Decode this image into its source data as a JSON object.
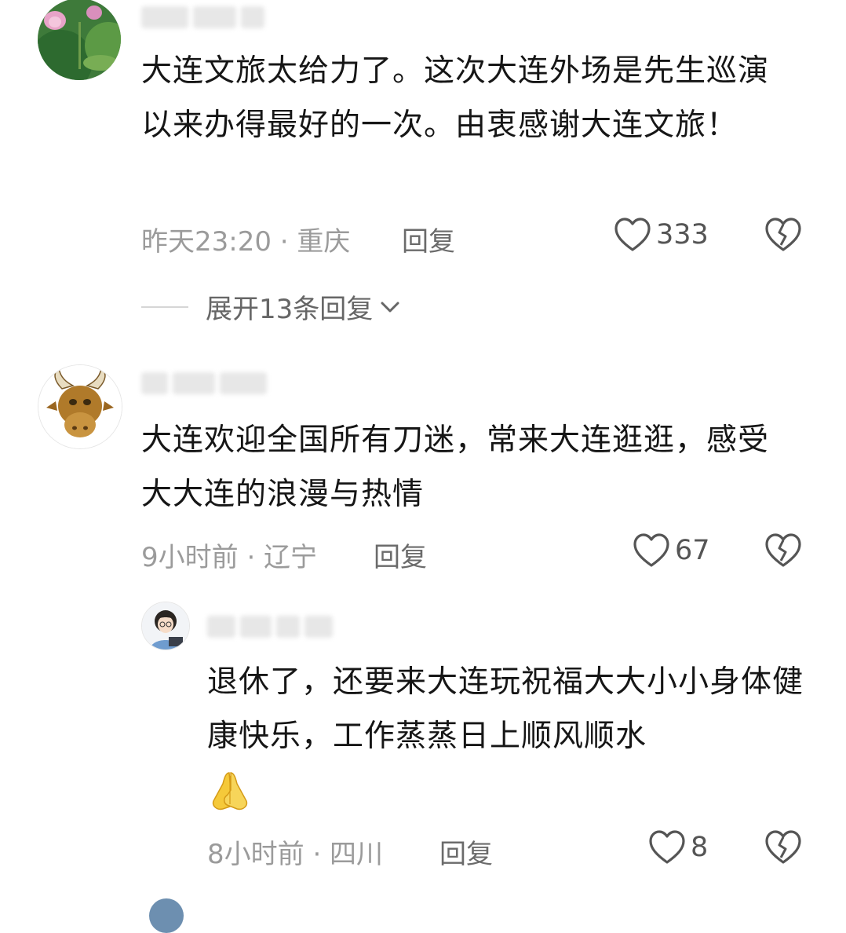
{
  "comments": [
    {
      "text": "大连文旅太给力了。这次大连外场是先生巡演以来办得最好的一次。由衷感谢大连文旅！",
      "time_location": "昨天23:20 · 重庆",
      "reply_label": "回复",
      "likes": "333",
      "avatar_icon": "lotus-avatar",
      "expand_label": "展开13条回复"
    },
    {
      "text": "大连欢迎全国所有刀迷，常来大连逛逛，感受大大连的浪漫与热情",
      "time_location": "9小时前 · 辽宁",
      "reply_label": "回复",
      "likes": "67",
      "avatar_icon": "bull-avatar"
    },
    {
      "text": "退休了，还要来大连玩祝福大大小小身体健康快乐，工作蒸蒸日上顺风顺水",
      "emoji": "praying-hands-emoji",
      "time_location": "8小时前 · 四川",
      "reply_label": "回复",
      "likes": "8",
      "avatar_icon": "girl-avatar"
    }
  ],
  "colors": {
    "text": "#161616",
    "meta": "#9b9b9b",
    "background": "#ffffff"
  }
}
